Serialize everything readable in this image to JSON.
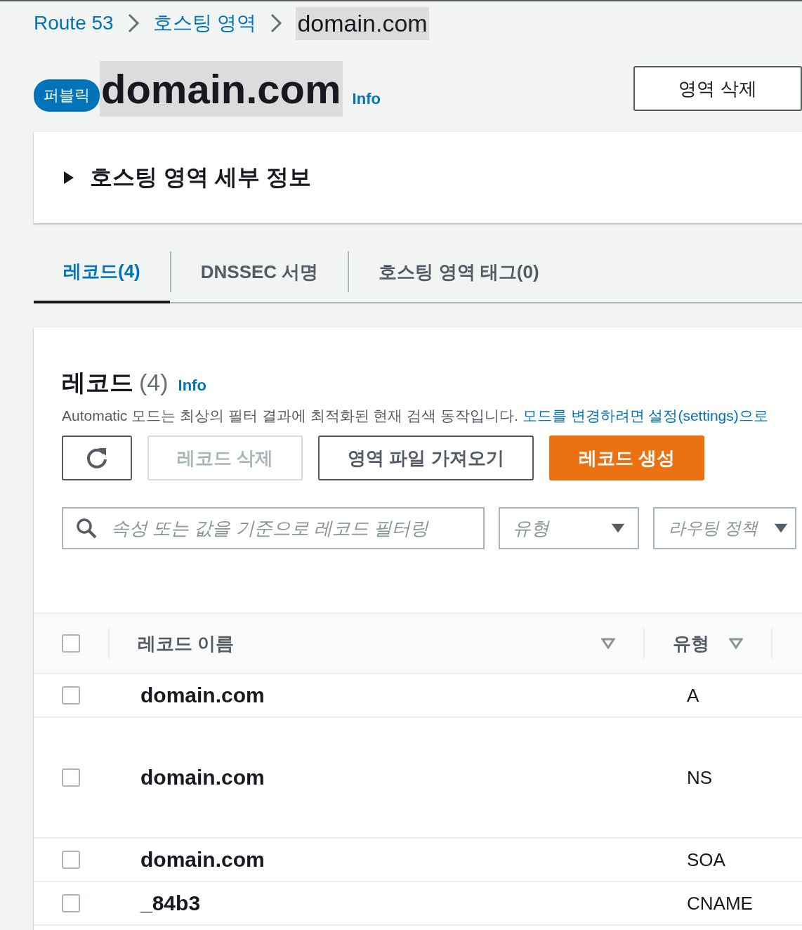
{
  "breadcrumb": [
    {
      "label": "Route 53",
      "kind": "link"
    },
    {
      "label": "호스팅 영역",
      "kind": "link"
    },
    {
      "label": "domain.com",
      "kind": "current"
    }
  ],
  "header": {
    "badge": "퍼블릭",
    "title": "domain.com",
    "info": "Info",
    "delete_button": "영역 삭제"
  },
  "details": {
    "title": "호스팅 영역 세부 정보",
    "expanded": false
  },
  "tabs": [
    {
      "label": "레코드(4)",
      "selected": true
    },
    {
      "label": "DNSSEC 서명",
      "selected": false
    },
    {
      "label": "호스팅 영역 태그(0)",
      "selected": false
    }
  ],
  "records": {
    "title": "레코드",
    "count": "(4)",
    "info": "Info",
    "description": "Automatic 모드는 최상의 필터 결과에 최적화된 현재 검색 동작입니다.",
    "link": "모드를 변경하려면 설정(settings)으로",
    "buttons": [
      {
        "kind": "refresh",
        "disabled": false
      },
      {
        "kind": "normal",
        "label": "레코드 삭제",
        "disabled": true
      },
      {
        "kind": "normal",
        "label": "영역 파일 가져오기",
        "disabled": false
      },
      {
        "kind": "primary",
        "label": "레코드 생성",
        "disabled": false
      }
    ],
    "search": {
      "placeholder": "속성 또는 값을 기준으로 레코드 필터링"
    },
    "filters": [
      {
        "placeholder": "유형"
      },
      {
        "placeholder": "라우팅 정책"
      }
    ],
    "table": {
      "select_all_checked": false,
      "columns": [
        "레코드 이름",
        "유형"
      ],
      "rows": [
        {
          "name": "domain.com",
          "type": "A",
          "checked": false
        },
        {
          "name": "domain.com",
          "type": "NS",
          "checked": false
        },
        {
          "name": "domain.com",
          "type": "SOA",
          "checked": false
        },
        {
          "name": "_84b3",
          "type": "CNAME",
          "checked": false
        }
      ]
    }
  }
}
